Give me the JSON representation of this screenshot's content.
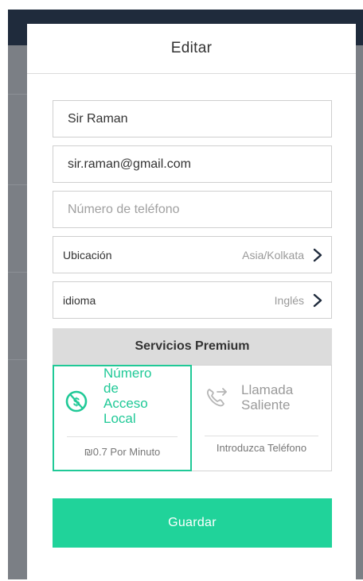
{
  "modal": {
    "title": "Editar"
  },
  "form": {
    "name": "Sir Raman",
    "email": "sir.raman@gmail.com",
    "phone_placeholder": "Número de teléfono",
    "location": {
      "label": "Ubicación",
      "value": "Asia/Kolkata"
    },
    "language": {
      "label": "idioma",
      "value": "Inglés"
    }
  },
  "premium": {
    "title": "Servicios Premium",
    "local_access": {
      "lines": [
        "Número",
        "de",
        "Acceso",
        "Local"
      ],
      "price": "₪0.7 Por Minuto",
      "icon": "dollar-slash-icon"
    },
    "outgoing_call": {
      "lines": [
        "Llamada",
        "Saliente"
      ],
      "prompt": "Introduzca Teléfono",
      "icon": "outgoing-call-icon"
    }
  },
  "save_label": "Guardar",
  "colors": {
    "accent": "#20d39a",
    "accent_text": "#20c997",
    "topbar": "#1f2b3c"
  }
}
